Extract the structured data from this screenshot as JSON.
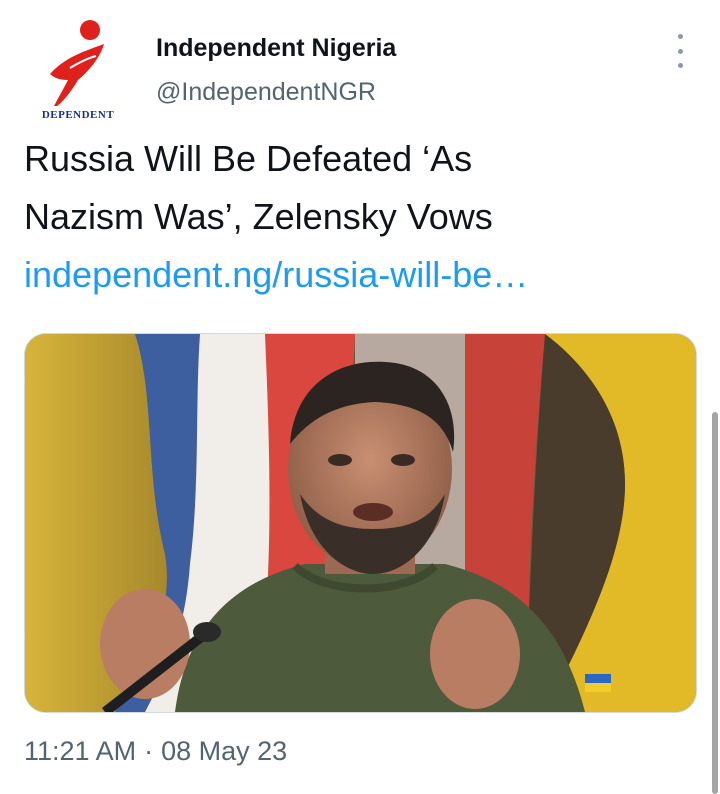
{
  "author": {
    "name": "Independent Nigeria",
    "handle": "@IndependentNGR",
    "avatar_logo_text": "DEPENDENT",
    "avatar_icon": "independent-logo-icon"
  },
  "tweet": {
    "text_lines": [
      "Russia Will Be Defeated ‘As",
      "Nazism Was’, Zelensky Vows"
    ],
    "link": "independent.ng/russia-will-be…",
    "media": {
      "description_icon": "photo-icon"
    }
  },
  "meta": {
    "time": "11:21 AM",
    "separator": "·",
    "date": "08 May 23"
  },
  "menu": {
    "icon": "more-options-icon"
  },
  "colors": {
    "link": "#1d9bf0",
    "secondary_text": "#536471",
    "brand_red": "#e0201b",
    "brand_blue": "#1b2f8a"
  }
}
